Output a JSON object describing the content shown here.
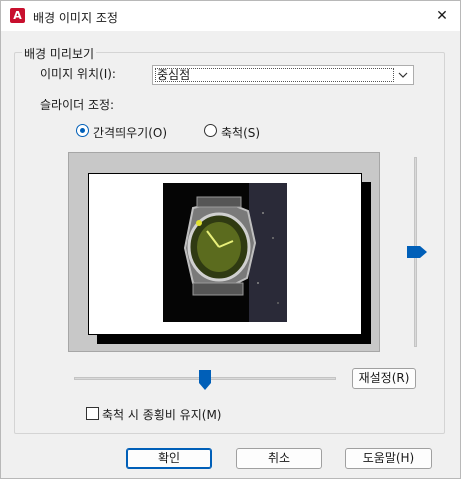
{
  "window": {
    "title": "배경 이미지 조정",
    "app_icon_letter": "A",
    "close_glyph": "✕"
  },
  "group": {
    "legend": "배경 미리보기",
    "position_label": "이미지 위치(I):",
    "position_value": "중심점",
    "slider_label": "슬라이더 조정:",
    "radio_tile": "간격띄우기(O)",
    "radio_scale": "축척(S)",
    "selected_radio": "tile",
    "reset_button": "재설정(R)",
    "keep_ratio_checkbox": "축척 시 종횡비 유지(M)",
    "keep_ratio_checked": false
  },
  "buttons": {
    "ok": "확인",
    "cancel": "취소",
    "help": "도움말(H)"
  },
  "colors": {
    "accent": "#005fb8",
    "app_icon": "#c8102e",
    "preview_bg": "#c8c8c8"
  },
  "icons": {
    "app": "autocad-app-icon",
    "close": "close-icon",
    "dropdown": "chevron-down-icon"
  }
}
